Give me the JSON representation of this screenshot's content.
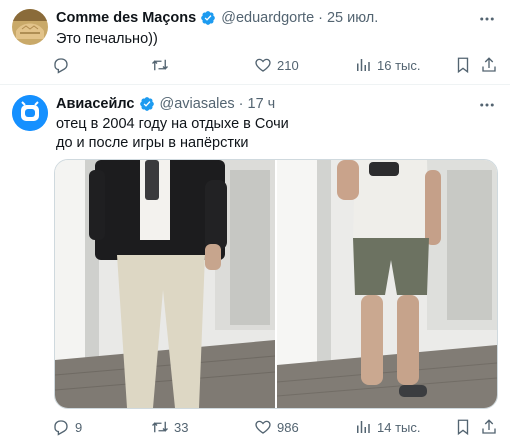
{
  "tweet1": {
    "author_name": "Comme des Maçons",
    "handle": "@eduardgorte",
    "sep": "·",
    "time": "25 июл.",
    "text": "Это печально))",
    "replies": "",
    "retweets": "",
    "likes": "210",
    "views": "16 тыс."
  },
  "tweet2": {
    "author_name": "Авиасейлс",
    "handle": "@aviasales",
    "sep": "·",
    "time": "17 ч",
    "text_line1": "отец в 2004 году на отдыхе в Сочи",
    "text_line2": "до и после игры в напёрстки",
    "replies": "9",
    "retweets": "33",
    "likes": "986",
    "views": "14 тыс."
  },
  "colors": {
    "verified": "#1d9bf0",
    "muted": "#536471",
    "divider": "#eff3f4"
  },
  "icons": [
    "reply-icon",
    "retweet-icon",
    "like-icon",
    "views-icon",
    "bookmark-icon",
    "share-icon",
    "verified-badge-icon",
    "more-icon"
  ]
}
